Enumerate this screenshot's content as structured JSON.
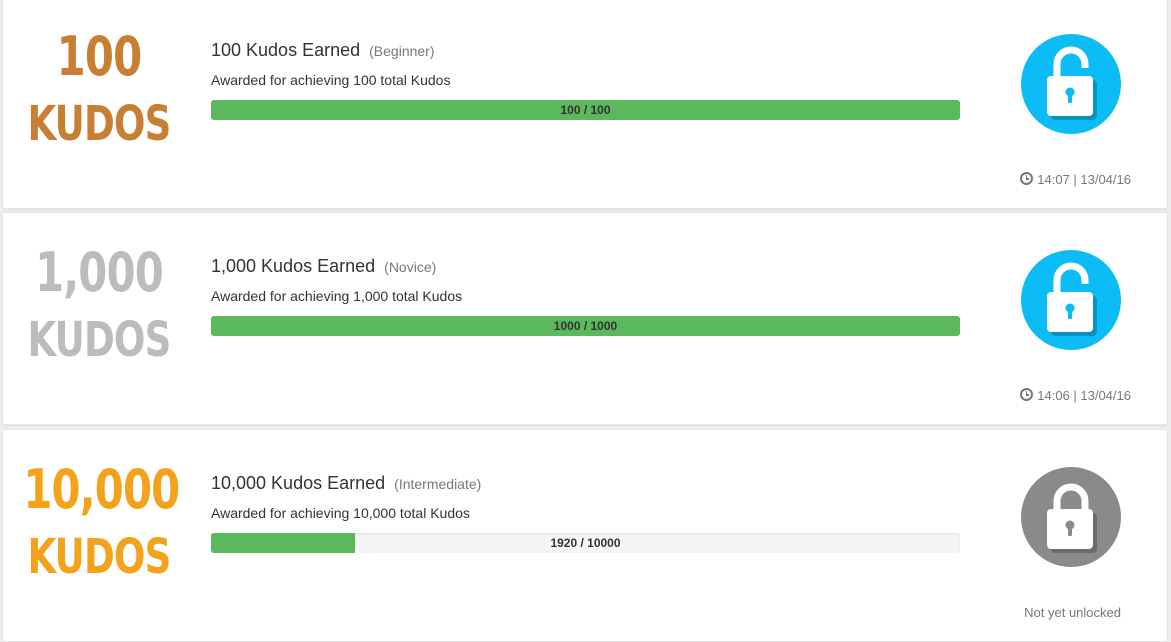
{
  "achievements": [
    {
      "badge_number": "100",
      "badge_unit": "KUDOS",
      "badge_color": "#c87f34",
      "title": "100 Kudos Earned",
      "level": "(Beginner)",
      "description": "Awarded for achieving 100 total Kudos",
      "progress_current": 100,
      "progress_target": 100,
      "progress_label": "100 / 100",
      "unlocked": true,
      "lock_icon": "unlocked-padlock-icon",
      "lock_color": "#0bbcf5",
      "status_icon": "clock-icon",
      "status_text": "14:07 | 13/04/16"
    },
    {
      "badge_number": "1,000",
      "badge_unit": "KUDOS",
      "badge_color": "#bcbcbc",
      "title": "1,000 Kudos Earned",
      "level": "(Novice)",
      "description": "Awarded for achieving 1,000 total Kudos",
      "progress_current": 1000,
      "progress_target": 1000,
      "progress_label": "1000 / 1000",
      "unlocked": true,
      "lock_icon": "unlocked-padlock-icon",
      "lock_color": "#0bbcf5",
      "status_icon": "clock-icon",
      "status_text": "14:06 | 13/04/16"
    },
    {
      "badge_number": "10,000",
      "badge_unit": "KUDOS",
      "badge_color": "#f2a21b",
      "title": "10,000 Kudos Earned",
      "level": "(Intermediate)",
      "description": "Awarded for achieving 10,000 total Kudos",
      "progress_current": 1920,
      "progress_target": 10000,
      "progress_label": "1920 / 10000",
      "unlocked": false,
      "lock_icon": "locked-padlock-icon",
      "lock_color": "#8a8a8a",
      "status_icon": "",
      "status_text": "Not yet unlocked"
    }
  ],
  "colors": {
    "progress_fill": "#5cb85c",
    "progress_track": "#f5f5f5"
  }
}
